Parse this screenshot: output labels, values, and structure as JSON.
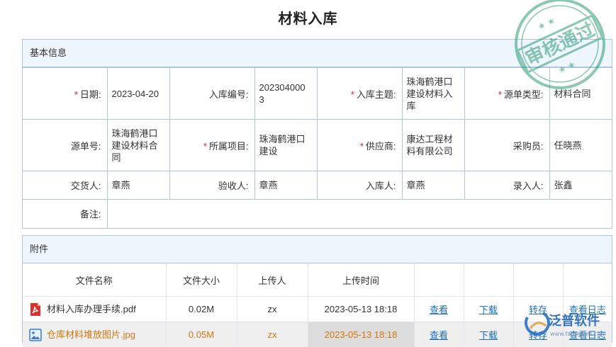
{
  "title": "材料入库",
  "basic": {
    "header": "基本信息",
    "rows": [
      [
        {
          "label": "日期:",
          "required": true,
          "value": "2023-04-20"
        },
        {
          "label": "入库编号:",
          "required": false,
          "value": "202304000 3"
        },
        {
          "label": "入库主题:",
          "required": true,
          "value": "珠海鹤港口建设材料入库"
        },
        {
          "label": "源单类型:",
          "required": true,
          "value": "材料合同"
        }
      ],
      [
        {
          "label": "源单号:",
          "required": false,
          "value": "珠海鹤港口建设材料合同"
        },
        {
          "label": "所属项目:",
          "required": true,
          "value": "珠海鹤港口建设"
        },
        {
          "label": "供应商:",
          "required": true,
          "value": "康达工程材料有限公司"
        },
        {
          "label": "采购员:",
          "required": false,
          "value": "任晓燕"
        }
      ],
      [
        {
          "label": "交货人:",
          "required": false,
          "value": "章燕"
        },
        {
          "label": "验收人:",
          "required": false,
          "value": "章燕"
        },
        {
          "label": "入库人:",
          "required": false,
          "value": "章燕"
        },
        {
          "label": "录入人:",
          "required": false,
          "value": "张鑫"
        }
      ]
    ],
    "remark_label": "备注:",
    "remark_value": ""
  },
  "attachments": {
    "header": "附件",
    "columns": [
      "文件名称",
      "文件大小",
      "上传人",
      "上传时间",
      "",
      "",
      "",
      ""
    ],
    "files": [
      {
        "icon": "pdf-file-icon",
        "name": "材料入库办理手续.pdf",
        "size": "0.02M",
        "uploader": "zx",
        "time": "2023-05-13 18:18",
        "view": "查看",
        "download": "下载",
        "transfer": "转存",
        "log": "查看日志"
      },
      {
        "icon": "image-file-icon",
        "name": "仓库材料堆放图片.jpg",
        "size": "0.05M",
        "uploader": "zx",
        "time": "2023-05-13 18:18",
        "view": "查看",
        "download": "下载",
        "transfer": "转存",
        "log": "查看日志"
      }
    ]
  },
  "stamp": {
    "text": "审核通过"
  },
  "brand": {
    "name": "泛普软件",
    "url": "www.fanpusoft.com"
  },
  "colors": {
    "border": "#a9c6e2",
    "header_bg": "#eef5fc",
    "required": "#e02020",
    "link": "#1f6fb9",
    "stamp": "#2e9a78",
    "highlight_text": "#d4760e"
  }
}
